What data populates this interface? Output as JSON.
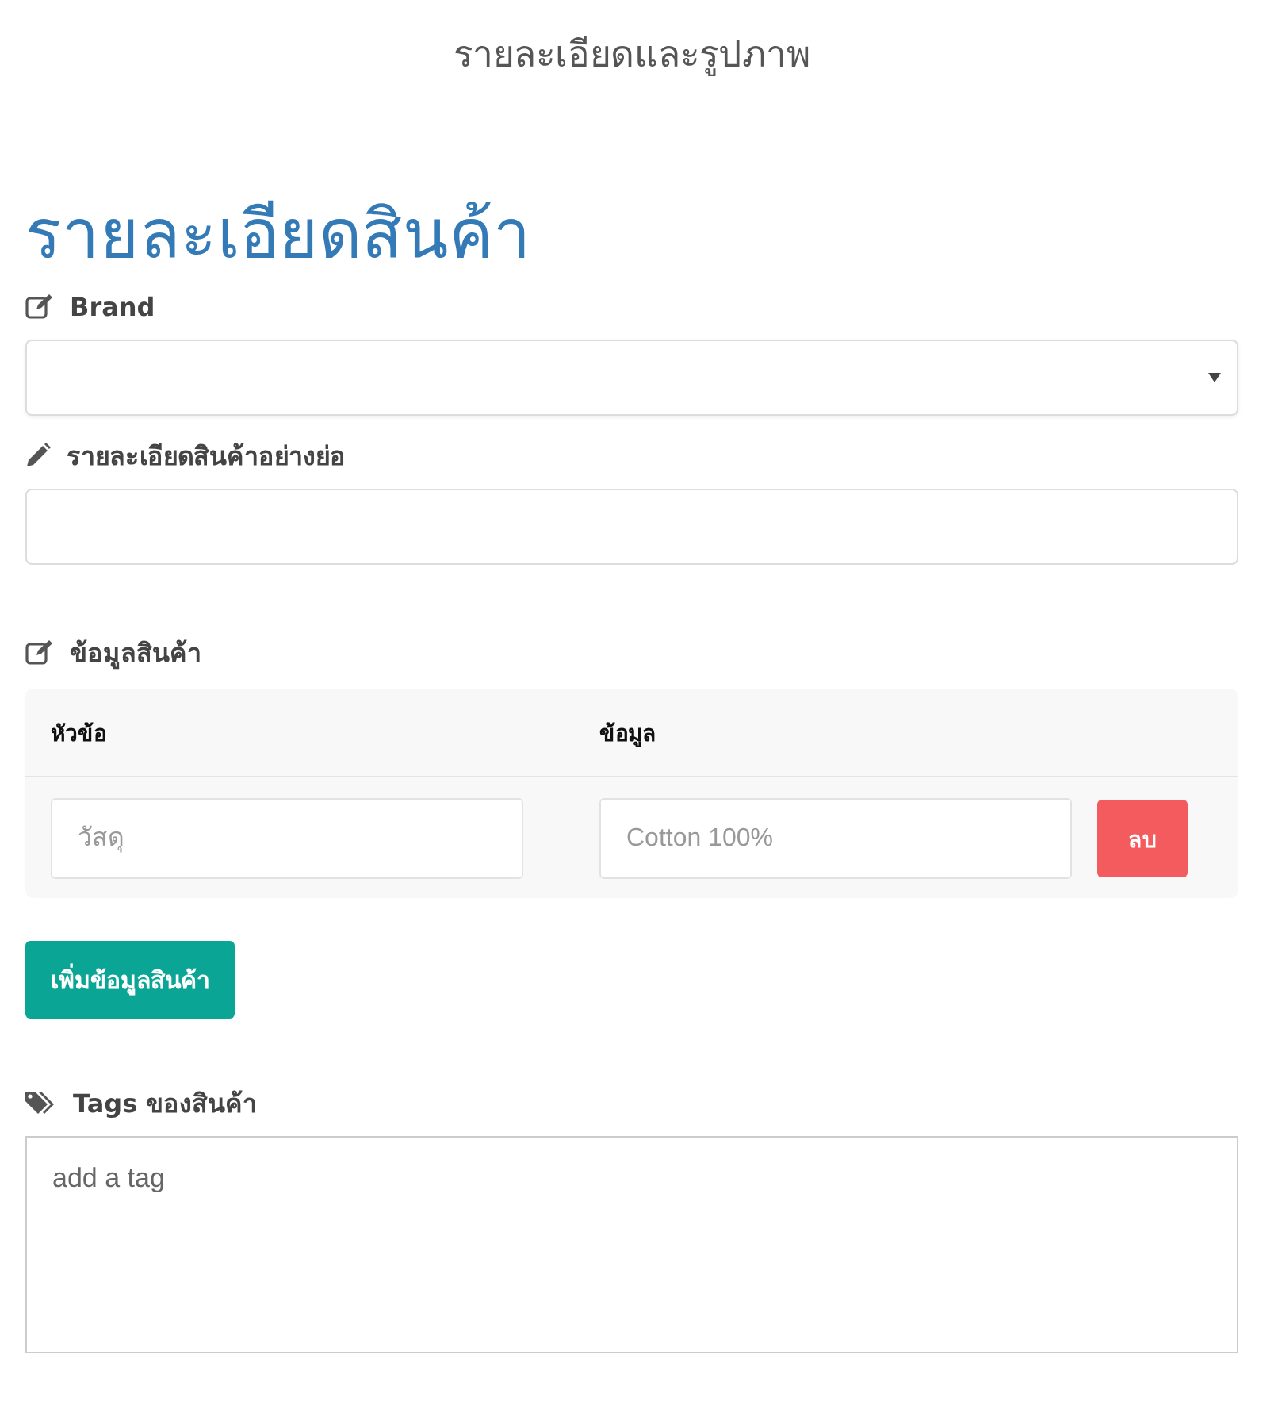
{
  "page_title": "รายละเอียดและรูปภาพ",
  "heading": "รายละเอียดสินค้า",
  "sections": [
    {
      "kind": "select",
      "label": "Brand"
    },
    {
      "kind": "input",
      "label": "รายละเอียดสินค้าอย่างย่อ"
    },
    {
      "kind": "table",
      "label": "ข้อมูลสินค้า",
      "columns": [
        "หัวข้อ",
        "ข้อมูล"
      ],
      "rows": [
        {
          "topic_placeholder": "วัสดุ",
          "info_placeholder": "Cotton 100%",
          "delete_label": "ลบ"
        }
      ],
      "add_button": "เพิ่มข้อมูลสินค้า"
    },
    {
      "kind": "tags",
      "label": "Tags ของสินค้า",
      "placeholder": "add a tag"
    }
  ]
}
